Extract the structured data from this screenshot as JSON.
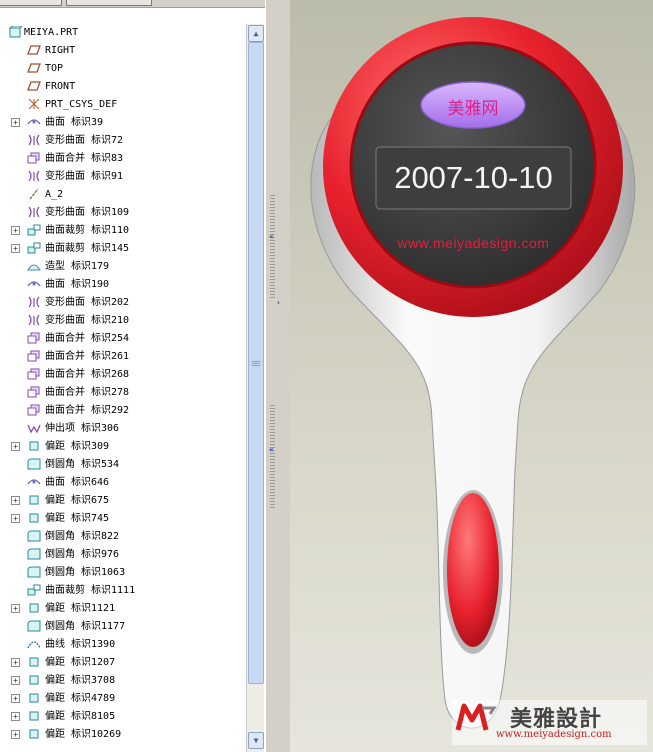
{
  "tree": {
    "root": "MEIYA.PRT",
    "items": [
      {
        "label": "RIGHT",
        "icon": "datum-plane-icon",
        "expandable": false
      },
      {
        "label": "TOP",
        "icon": "datum-plane-icon",
        "expandable": false
      },
      {
        "label": "FRONT",
        "icon": "datum-plane-icon",
        "expandable": false
      },
      {
        "label": "PRT_CSYS_DEF",
        "icon": "coordinate-system-icon",
        "expandable": false
      },
      {
        "label": "曲面 标识39",
        "icon": "surface-icon",
        "expandable": true
      },
      {
        "label": "变形曲面 标识72",
        "icon": "warp-surface-icon",
        "expandable": false
      },
      {
        "label": "曲面合并 标识83",
        "icon": "merge-surface-icon",
        "expandable": false
      },
      {
        "label": "变形曲面 标识91",
        "icon": "warp-surface-icon",
        "expandable": false
      },
      {
        "label": "A_2",
        "icon": "datum-axis-icon",
        "expandable": false
      },
      {
        "label": "变形曲面 标识109",
        "icon": "warp-surface-icon",
        "expandable": false
      },
      {
        "label": "曲面裁剪 标识110",
        "icon": "trim-surface-icon",
        "expandable": true
      },
      {
        "label": "曲面裁剪 标识145",
        "icon": "trim-surface-icon",
        "expandable": true
      },
      {
        "label": "造型 标识179",
        "icon": "style-icon",
        "expandable": false
      },
      {
        "label": "曲面 标识190",
        "icon": "surface-icon",
        "expandable": false
      },
      {
        "label": "变形曲面 标识202",
        "icon": "warp-surface-icon",
        "expandable": false
      },
      {
        "label": "变形曲面 标识210",
        "icon": "warp-surface-icon",
        "expandable": false
      },
      {
        "label": "曲面合并 标识254",
        "icon": "merge-surface-icon",
        "expandable": false
      },
      {
        "label": "曲面合并 标识261",
        "icon": "merge-surface-icon",
        "expandable": false
      },
      {
        "label": "曲面合并 标识268",
        "icon": "merge-surface-icon",
        "expandable": false
      },
      {
        "label": "曲面合并 标识278",
        "icon": "merge-surface-icon",
        "expandable": false
      },
      {
        "label": "曲面合并 标识292",
        "icon": "merge-surface-icon",
        "expandable": false
      },
      {
        "label": "伸出项 标识306",
        "icon": "extrude-icon",
        "expandable": false
      },
      {
        "label": "偏距 标识309",
        "icon": "offset-icon",
        "expandable": true
      },
      {
        "label": "倒圆角 标识534",
        "icon": "round-icon",
        "expandable": false
      },
      {
        "label": "曲面 标识646",
        "icon": "surface-icon",
        "expandable": false
      },
      {
        "label": "偏距 标识675",
        "icon": "offset-icon",
        "expandable": true
      },
      {
        "label": "偏距 标识745",
        "icon": "offset-icon",
        "expandable": true
      },
      {
        "label": "倒圆角 标识822",
        "icon": "round-icon",
        "expandable": false
      },
      {
        "label": "倒圆角 标识976",
        "icon": "round-icon",
        "expandable": false
      },
      {
        "label": "倒圆角 标识1063",
        "icon": "round-icon",
        "expandable": false
      },
      {
        "label": "曲面裁剪 标识1111",
        "icon": "trim-surface-icon",
        "expandable": false
      },
      {
        "label": "偏距 标识1121",
        "icon": "offset-icon",
        "expandable": true
      },
      {
        "label": "倒圆角 标识1177",
        "icon": "round-icon",
        "expandable": false
      },
      {
        "label": "曲线 标识1390",
        "icon": "curve-icon",
        "expandable": false
      },
      {
        "label": "偏距 标识1207",
        "icon": "offset-icon",
        "expandable": true
      },
      {
        "label": "偏距 标识3708",
        "icon": "offset-icon",
        "expandable": true
      },
      {
        "label": "偏距 标识4789",
        "icon": "offset-icon",
        "expandable": true
      },
      {
        "label": "偏距 标识8105",
        "icon": "offset-icon",
        "expandable": true
      },
      {
        "label": "偏距 标识10269",
        "icon": "offset-icon",
        "expandable": true
      }
    ]
  },
  "model": {
    "badge_text": "美雅网",
    "date_text": "2007-10-10",
    "url_text": "www.meiyadesign.com",
    "colors": {
      "red": "#e8222e",
      "dark_face": "#3a3a3a",
      "handle": "#eeeeee",
      "badge": "#b980f0",
      "url": "#e0203a"
    }
  },
  "watermark": {
    "brand_text": "美雅設計",
    "url_text": "www.meiyadesign.com"
  }
}
